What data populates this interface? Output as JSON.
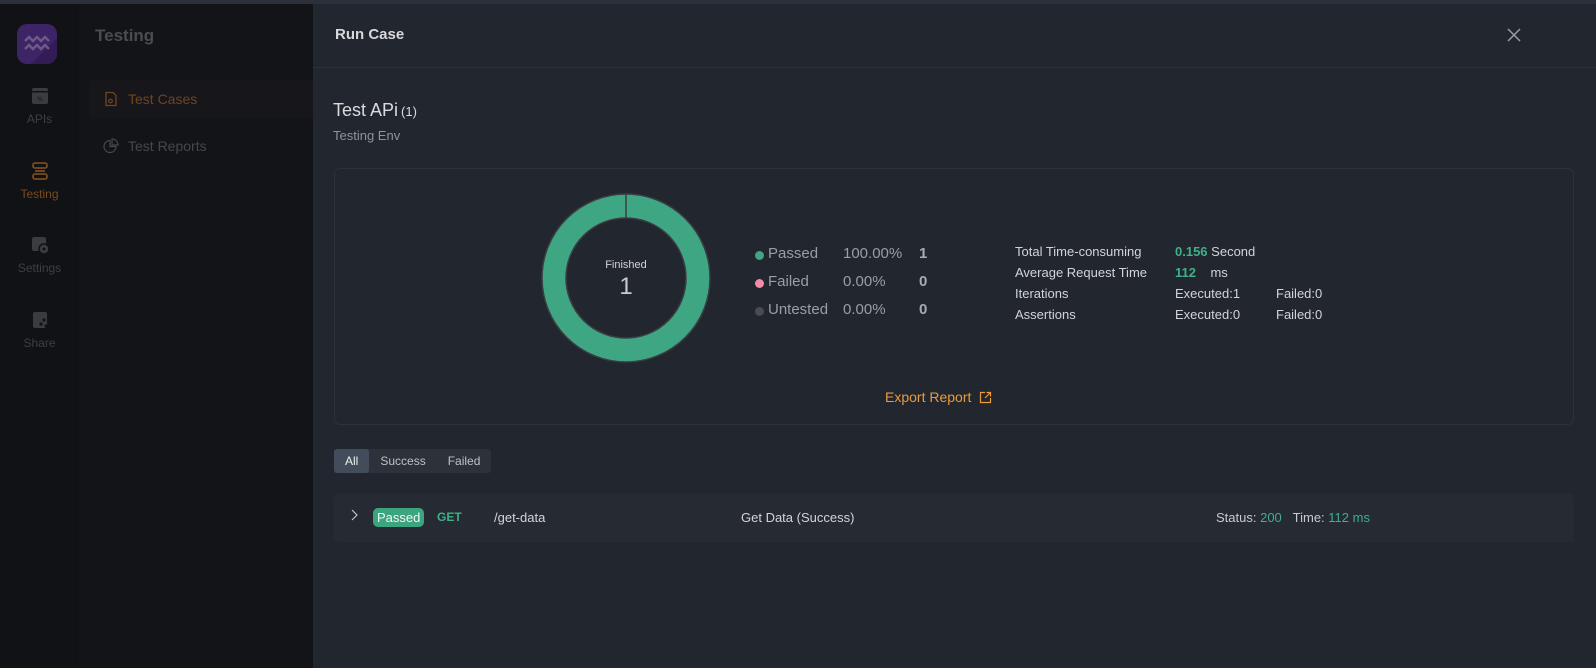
{
  "app": {
    "rail": [
      {
        "label": "APIs",
        "icon": "api-icon",
        "active": false
      },
      {
        "label": "Testing",
        "icon": "testing-icon",
        "active": true
      },
      {
        "label": "Settings",
        "icon": "settings-icon",
        "active": false
      },
      {
        "label": "Share",
        "icon": "share-icon",
        "active": false
      }
    ],
    "subnav": {
      "title": "Testing",
      "items": [
        {
          "label": "Test Cases",
          "icon": "test-case-icon",
          "active": true
        },
        {
          "label": "Test Reports",
          "icon": "pie-chart-icon",
          "active": false
        }
      ]
    }
  },
  "drawer": {
    "title": "Run Case",
    "suite": {
      "name": "Test APi",
      "count": "(1)",
      "env": "Testing Env"
    },
    "summary": {
      "donut_label": "Finished",
      "donut_value": "1",
      "legend": [
        {
          "name": "Passed",
          "pct": "100.00%",
          "count": "1",
          "color": "#3fa683"
        },
        {
          "name": "Failed",
          "pct": "0.00%",
          "count": "0",
          "color": "#f08ca8"
        },
        {
          "name": "Untested",
          "pct": "0.00%",
          "count": "0",
          "color": "#4a4b4e"
        }
      ],
      "stats": {
        "total_time_label": "Total Time-consuming",
        "total_time_value": "0.156",
        "total_time_unit": "Second",
        "avg_time_label": "Average Request Time",
        "avg_time_value": "112",
        "avg_time_unit": "ms",
        "iterations_label": "Iterations",
        "iterations_executed": "Executed:1",
        "iterations_failed": "Failed:0",
        "assertions_label": "Assertions",
        "assertions_executed": "Executed:0",
        "assertions_failed": "Failed:0"
      },
      "export_label": "Export Report"
    },
    "filters": [
      {
        "label": "All",
        "active": true
      },
      {
        "label": "Success",
        "active": false
      },
      {
        "label": "Failed",
        "active": false
      }
    ],
    "results": [
      {
        "badge": "Passed",
        "method": "GET",
        "path": "/get-data",
        "name": "Get Data (Success)",
        "status_label": "Status:",
        "status_value": "200",
        "time_label": "Time:",
        "time_value": "112 ms"
      }
    ]
  },
  "chart_data": {
    "type": "pie",
    "title": "Finished",
    "categories": [
      "Passed",
      "Failed",
      "Untested"
    ],
    "values": [
      1,
      0,
      0
    ],
    "colors": [
      "#3fa683",
      "#f08ca8",
      "#4a4b4e"
    ]
  }
}
